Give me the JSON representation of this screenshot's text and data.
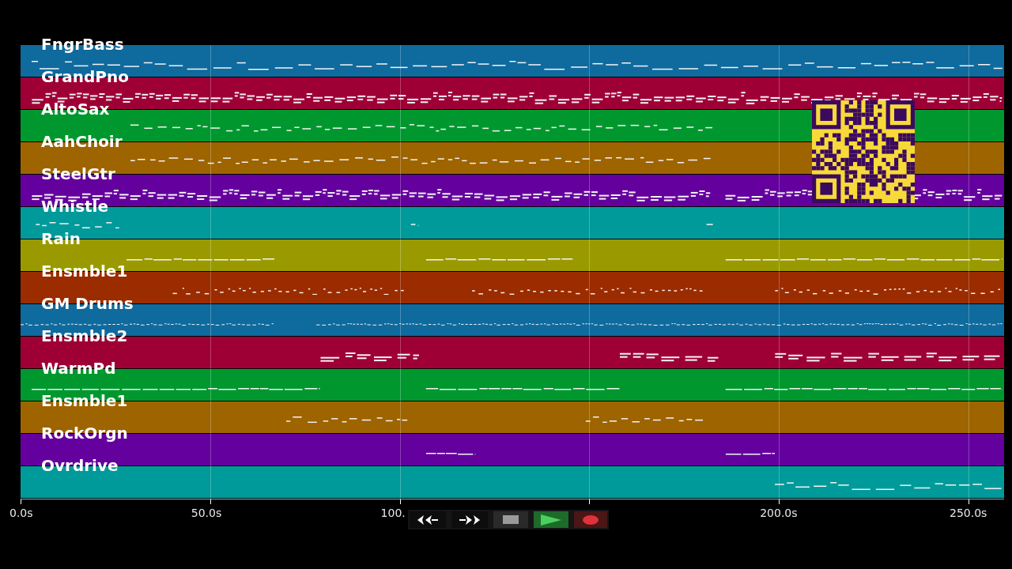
{
  "tracks": [
    {
      "name": "FngrBass",
      "color": "#0f6a9e"
    },
    {
      "name": "GrandPno",
      "color": "#9e0035"
    },
    {
      "name": "AltoSax",
      "color": "#00982e"
    },
    {
      "name": "AahChoir",
      "color": "#9e6400"
    },
    {
      "name": "SteelGtr",
      "color": "#64009e"
    },
    {
      "name": "Whistle",
      "color": "#009a9a"
    },
    {
      "name": "Rain",
      "color": "#9a9a00"
    },
    {
      "name": "Ensmble1",
      "color": "#9a2c00"
    },
    {
      "name": "GM Drums",
      "color": "#0f6a9e"
    },
    {
      "name": "Ensmble2",
      "color": "#9e0035"
    },
    {
      "name": "WarmPd",
      "color": "#00982e"
    },
    {
      "name": "Ensmble1",
      "color": "#9e6400"
    },
    {
      "name": "RockOrgn",
      "color": "#64009e"
    },
    {
      "name": "Ovrdrive",
      "color": "#009a9a"
    }
  ],
  "timeline": {
    "ticks": [
      "0.0s",
      "50.0s",
      "100.",
      "200.0s",
      "250.0s"
    ]
  },
  "transport": [
    {
      "kind": "rewind"
    },
    {
      "kind": "forward"
    },
    {
      "kind": "stop"
    },
    {
      "kind": "play"
    },
    {
      "kind": "record"
    }
  ]
}
